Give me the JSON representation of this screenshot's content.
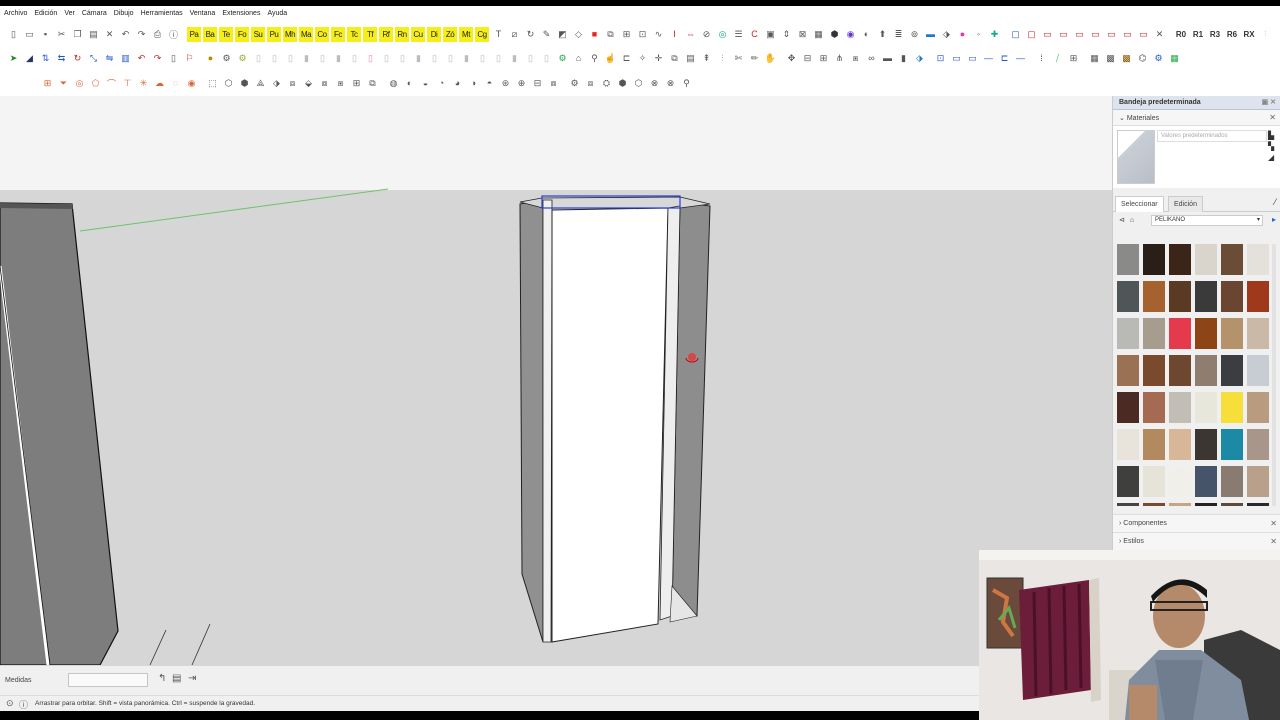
{
  "menu": [
    "Archivo",
    "Edición",
    "Ver",
    "Cámara",
    "Dibujo",
    "Herramientas",
    "Ventana",
    "Extensiones",
    "Ayuda"
  ],
  "toolbar_yellow": [
    "Pa",
    "Ba",
    "Te",
    "Fo",
    "Su",
    "Pu",
    "Mh",
    "Ma",
    "Co",
    "Fc",
    "Tc",
    "Tf",
    "Rf",
    "Rn",
    "Cu",
    "Di",
    "Zó",
    "Mt",
    "Cg"
  ],
  "toolbar_text_labels": [
    "R0",
    "R1",
    "R3",
    "R6",
    "RX"
  ],
  "tray": {
    "title": "Bandeja predeterminada",
    "materials_header": "Materiales",
    "preview_placeholder": "Valores predeterminados",
    "tab_select": "Seleccionar",
    "tab_edit": "Edición",
    "library": "PELIKANO",
    "swatch_colors": [
      "#8a8a88",
      "#2a1f18",
      "#3b2418",
      "#d9d4cc",
      "#6b4c36",
      "#e4e0da",
      "#505658",
      "#a5622e",
      "#5a3a22",
      "#3a3a3a",
      "#6a4632",
      "#a0391c",
      "#b9b9b6",
      "#a79d8f",
      "#e53a4b",
      "#8d4416",
      "#b4926c",
      "#c9b9a6",
      "#9b7153",
      "#7a4a2d",
      "#6e4730",
      "#8f7d6f",
      "#3b3d40",
      "#c8cdd4",
      "#4a2a22",
      "#a46a52",
      "#c2bdb5",
      "#e8e7dc",
      "#f6df3b",
      "#b99b7f",
      "#e8e4dc",
      "#b3895f",
      "#d8b698",
      "#3c3633",
      "#1d8aa5",
      "#a8968a",
      "#3f3f3d",
      "#e6e3d8",
      "#f1efea",
      "#46546a",
      "#897b70",
      "#b9a08a",
      "#444444",
      "#7a4a2e",
      "#c7a57e",
      "#222",
      "#5e4a3a",
      "#2a2a2a"
    ],
    "components": "Componentes",
    "styles": "Estilos"
  },
  "measures_label": "Medidas",
  "status_text": "Arrastrar para orbitar. Shift = vista panorámica. Ctrl = suspende la gravedad."
}
